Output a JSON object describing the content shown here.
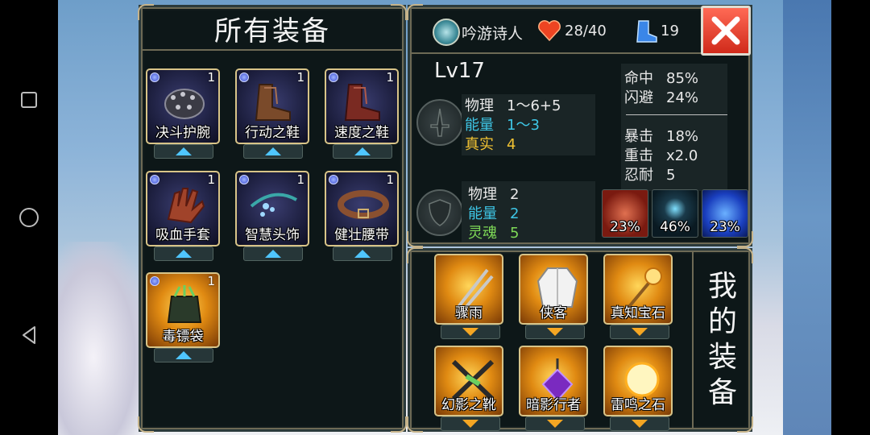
{
  "left_panel": {
    "title": "所有装备",
    "items": [
      {
        "name": "决斗护腕",
        "count": "1",
        "icon": "spiked-bracer-icon"
      },
      {
        "name": "行动之鞋",
        "count": "1",
        "icon": "boots-icon"
      },
      {
        "name": "速度之鞋",
        "count": "1",
        "icon": "red-boots-icon"
      },
      {
        "name": "吸血手套",
        "count": "1",
        "icon": "glove-icon"
      },
      {
        "name": "智慧头饰",
        "count": "1",
        "icon": "circlet-icon"
      },
      {
        "name": "健壮腰带",
        "count": "1",
        "icon": "belt-icon"
      },
      {
        "name": "毒镖袋",
        "count": "1",
        "icon": "dart-pouch-icon"
      }
    ]
  },
  "header": {
    "class_name": "吟游诗人",
    "hp": "28/40",
    "moves": "19"
  },
  "stats": {
    "level": "Lv17",
    "attack": [
      {
        "label": "物理",
        "value": "1～6+5",
        "color": "#f0f0f0"
      },
      {
        "label": "能量",
        "value": "1～3",
        "color": "#3ec6e6"
      },
      {
        "label": "真实",
        "value": "4",
        "color": "#f1c232"
      }
    ],
    "defense": [
      {
        "label": "物理",
        "value": "2",
        "color": "#f0f0f0"
      },
      {
        "label": "能量",
        "value": "2",
        "color": "#3ec6e6"
      },
      {
        "label": "灵魂",
        "value": "5",
        "color": "#7ed957"
      }
    ],
    "accuracy": [
      {
        "label": "命中",
        "value": "85%"
      },
      {
        "label": "闪避",
        "value": "24%"
      }
    ],
    "crit": [
      {
        "label": "暴击",
        "value": "18%"
      },
      {
        "label": "重击",
        "value": "x2.0"
      },
      {
        "label": "忍耐",
        "value": "5"
      }
    ],
    "buffs": [
      {
        "value": "23%",
        "icon": "blood-fist-icon"
      },
      {
        "value": "46%",
        "icon": "sparkle-icon"
      },
      {
        "value": "23%",
        "icon": "brain-icon"
      }
    ]
  },
  "my_equipment": {
    "title": [
      "我",
      "的",
      "装",
      "备"
    ],
    "items": [
      {
        "name": "骤雨",
        "icon": "twin-swords-icon"
      },
      {
        "name": "侠客",
        "icon": "white-robe-icon"
      },
      {
        "name": "真知宝石",
        "icon": "gem-staff-icon"
      },
      {
        "name": "幻影之靴",
        "icon": "crossed-blades-icon"
      },
      {
        "name": "暗影行者",
        "icon": "purple-amulet-icon"
      },
      {
        "name": "雷鸣之石",
        "icon": "thunder-stone-icon"
      }
    ]
  },
  "colors": {
    "frame_gold": "#d8c488",
    "close_red": "#d02a1a",
    "panel_bg": "#0d1718"
  }
}
